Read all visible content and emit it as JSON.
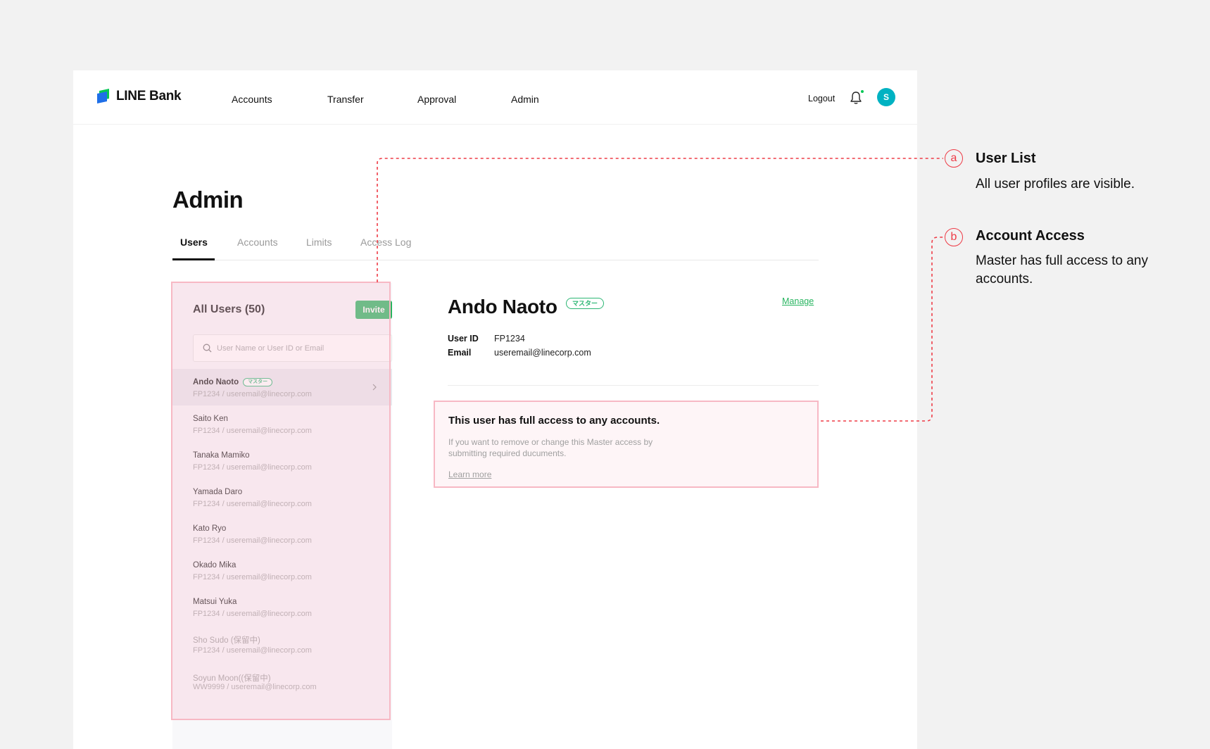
{
  "brand": {
    "name": "LINE Bank"
  },
  "nav": {
    "items": [
      "Accounts",
      "Transfer",
      "Approval",
      "Admin"
    ],
    "logout": "Logout",
    "avatar_initial": "S"
  },
  "page": {
    "title": "Admin",
    "tabs": [
      "Users",
      "Accounts",
      "Limits",
      "Access Log"
    ],
    "active_tab": "Users"
  },
  "user_list": {
    "title": "All Users (50)",
    "invite_label": "Invite",
    "search_placeholder": "User Name or User ID or Email",
    "users": [
      {
        "name": "Ando Naoto",
        "badge": "マスター",
        "sub": "FP1234 / useremail@linecorp.com",
        "selected": true
      },
      {
        "name": "Saito Ken",
        "sub": "FP1234 / useremail@linecorp.com"
      },
      {
        "name": "Tanaka Mamiko",
        "sub": "FP1234 / useremail@linecorp.com"
      },
      {
        "name": "Yamada Daro",
        "sub": "FP1234 / useremail@linecorp.com"
      },
      {
        "name": "Kato Ryo",
        "sub": "FP1234 / useremail@linecorp.com"
      },
      {
        "name": "Okado Mika",
        "sub": "FP1234 / useremail@linecorp.com"
      },
      {
        "name": "Matsui Yuka",
        "sub": "FP1234 / useremail@linecorp.com"
      },
      {
        "name": "Sho Sudo (保留中)",
        "sub": "FP1234 / useremail@linecorp.com",
        "muted": true
      },
      {
        "name": "Soyun Moon((保留中)",
        "sub": "WW9999 /  useremail@linecorp.com",
        "muted": true
      }
    ]
  },
  "detail": {
    "name": "Ando Naoto",
    "badge": "マスター",
    "manage_label": "Manage",
    "user_id_label": "User ID",
    "user_id": "FP1234",
    "email_label": "Email",
    "email": "useremail@linecorp.com",
    "access_title": "This user has full access to any accounts.",
    "access_desc": "If you want to remove or change this Master access by submitting required ducuments.",
    "learn_more": "Learn more"
  },
  "annotations": [
    {
      "marker": "a",
      "title": "User List",
      "desc": "All user profiles are visible."
    },
    {
      "marker": "b",
      "title": "Account Access",
      "desc": "Master has full access to any accounts."
    }
  ],
  "colors": {
    "brand_green": "#27b45f",
    "badge_green": "#2bb673",
    "annotation_red": "#ee3b46",
    "highlight_pink": "#f7b8c4",
    "avatar_teal": "#00b2c2"
  }
}
